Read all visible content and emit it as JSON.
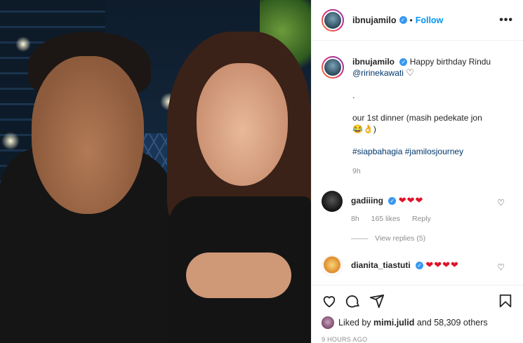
{
  "post": {
    "author": "ibnujamilo",
    "follow_label": "Follow",
    "dot": "•",
    "more_label": "•••"
  },
  "caption": {
    "author": "ibnujamilo",
    "line1": "Happy birthday Rindu",
    "mention": "@ririnekawati",
    "heart": "♡",
    "dot_line": ".",
    "line2": "our 1st dinner (masih pedekate jon",
    "line2b": "😂👌)",
    "hashtags": "#siapbahagia #jamilosjourney",
    "time": "9h"
  },
  "comments": [
    {
      "user": "gadiiing",
      "text": "❤❤❤",
      "time": "8h",
      "likes": "165 likes",
      "reply": "Reply",
      "view_replies": "View replies (5)"
    },
    {
      "user": "dianita_tiastuti",
      "text": "❤❤❤❤"
    }
  ],
  "footer": {
    "liked_by_prefix": "Liked by",
    "liked_by_user": "mimi.julid",
    "liked_by_suffix": "and 58,309 others",
    "timestamp": "9 HOURS AGO"
  },
  "colors": {
    "link": "#0095f6",
    "verified": "#3897f0",
    "heart_red": "#e0122a"
  }
}
